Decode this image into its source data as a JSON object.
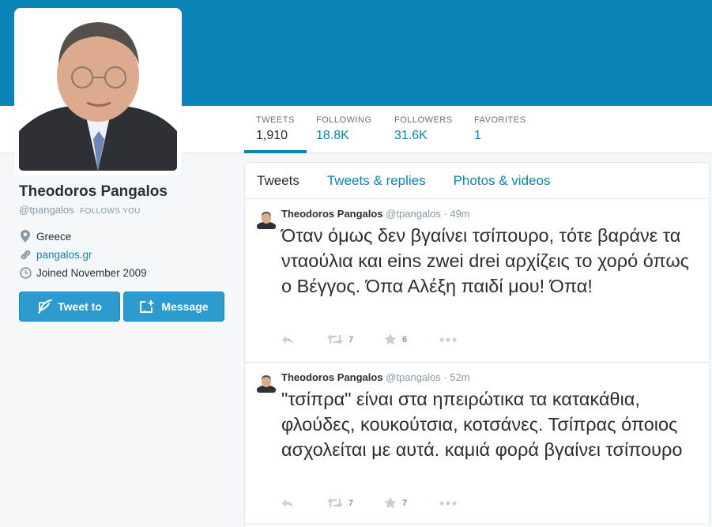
{
  "profile": {
    "name": "Theodoros Pangalos",
    "handle": "@tpangalos",
    "follows_you": "FOLLOWS YOU",
    "location": "Greece",
    "website": "pangalos.gr",
    "joined": "Joined November 2009"
  },
  "stats": [
    {
      "label": "TWEETS",
      "value": "1,910"
    },
    {
      "label": "FOLLOWING",
      "value": "18.8K"
    },
    {
      "label": "FOLLOWERS",
      "value": "31.6K"
    },
    {
      "label": "FAVORITES",
      "value": "1"
    }
  ],
  "buttons": {
    "tweet_to": "Tweet to",
    "message": "Message"
  },
  "tabs": [
    "Tweets",
    "Tweets & replies",
    "Photos & videos"
  ],
  "tweets": [
    {
      "name": "Theodoros Pangalos",
      "handle": "@tpangalos",
      "time": "· 49m",
      "text": "Όταν όμως δεν βγαίνει τσίπουρο, τότε βαράνε τα νταούλια και eins zwei drei αρχίζεις το χορό όπως ο Βέγγος. Όπα Αλέξη παιδί μου! Όπα!",
      "retweets": "7",
      "favorites": "6"
    },
    {
      "name": "Theodoros Pangalos",
      "handle": "@tpangalos",
      "time": "· 52m",
      "text": "\"τσίπρα\" είναι στα ηπειρώτικα τα κατακάθια, φλούδες, κουκούτσια, κοτσάνες. Τσίπρας όποιος ασχολείται με αυτά. καμιά φορά βγαίνει τσίπουρο",
      "retweets": "7",
      "favorites": "7"
    }
  ],
  "colors": {
    "header": "#0d84b8",
    "link": "#0d84b8",
    "button": "#2e9bcf"
  }
}
